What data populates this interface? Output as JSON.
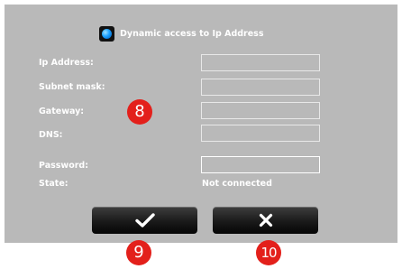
{
  "dynamic_toggle": {
    "label": "Dynamic access to Ip Address",
    "checked": true
  },
  "fields": {
    "ip_label": "Ip Address:",
    "ip_value": "",
    "subnet_label": "Subnet mask:",
    "subnet_value": "",
    "gateway_label": "Gateway:",
    "gateway_value": "",
    "dns_label": "DNS:",
    "dns_value": "",
    "password_label": "Password:",
    "password_value": "",
    "state_label": "State:",
    "state_value": "Not connected"
  },
  "buttons": {
    "confirm_icon": "checkmark-icon",
    "cancel_icon": "close-icon"
  },
  "callouts": {
    "one": "8",
    "two": "9",
    "three": "10"
  },
  "colors": {
    "panel": "#b9b9b9",
    "button": "#1a1a1a",
    "badge": "#e3201b",
    "toggle_dot": "#1aa0ff"
  }
}
